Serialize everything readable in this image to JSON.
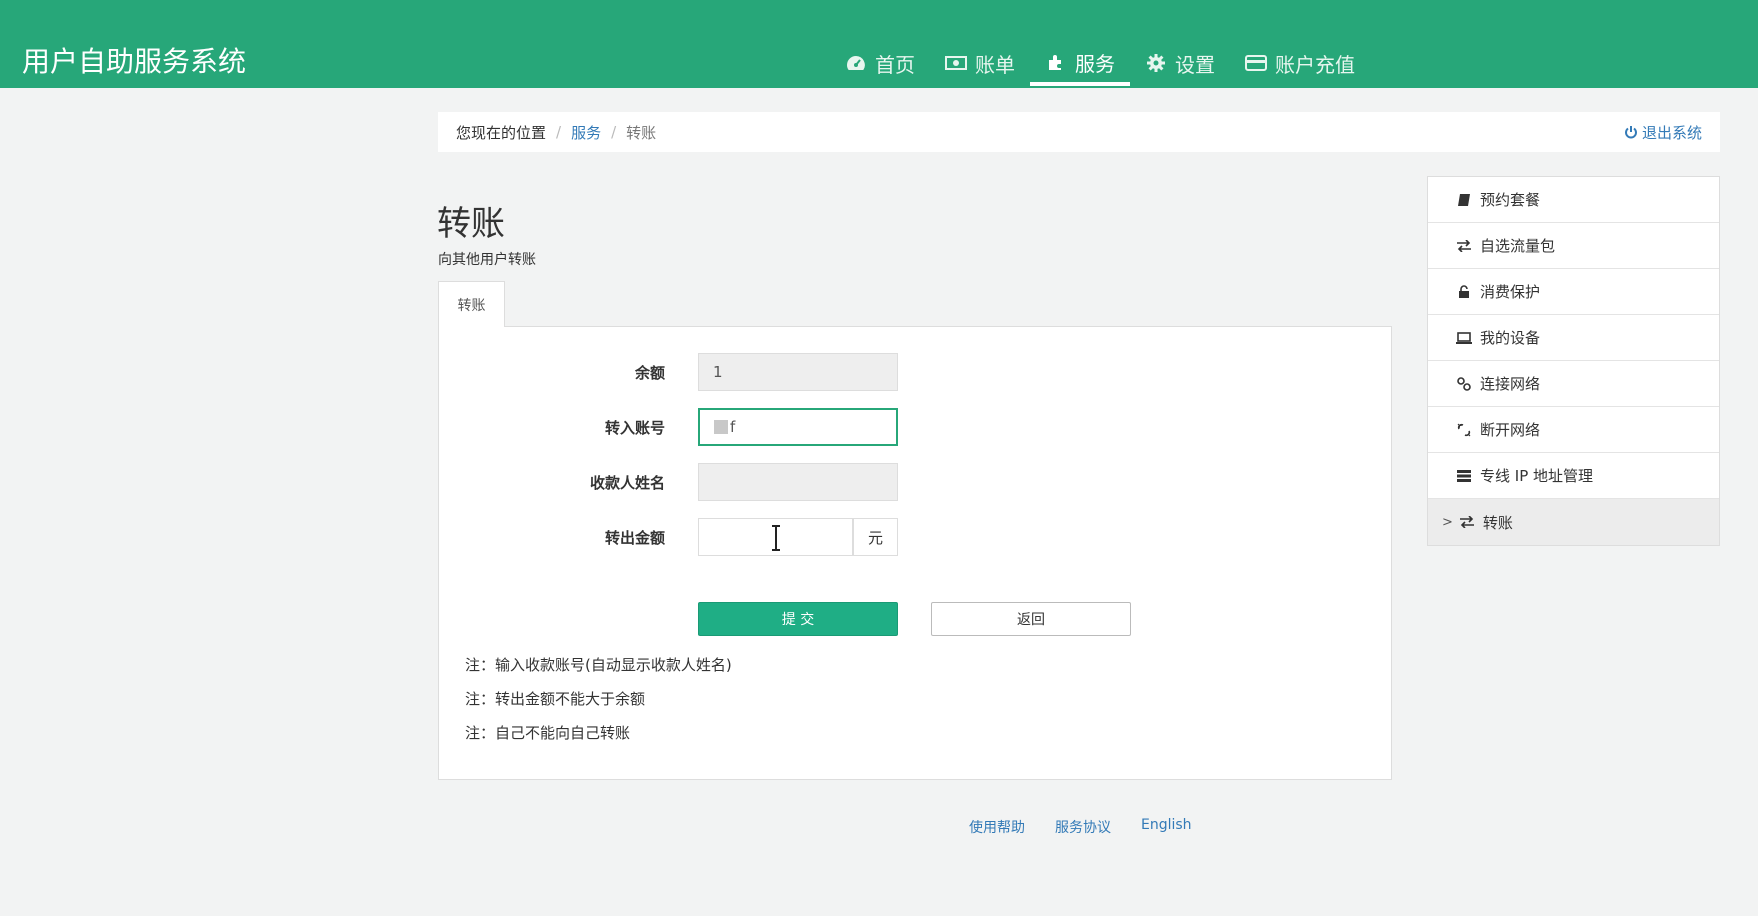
{
  "header": {
    "title": "用户自助服务系统",
    "nav": [
      {
        "label": "首页",
        "icon": "dashboard-icon"
      },
      {
        "label": "账单",
        "icon": "money-icon"
      },
      {
        "label": "服务",
        "icon": "puzzle-icon",
        "active": true
      },
      {
        "label": "设置",
        "icon": "gear-icon"
      },
      {
        "label": "账户充值",
        "icon": "credit-card-icon"
      }
    ]
  },
  "breadcrumb": {
    "prefix": "您现在的位置",
    "items": [
      "服务",
      "转账"
    ],
    "sep": "/",
    "logout": "退出系统"
  },
  "page": {
    "title": "转账",
    "subtitle": "向其他用户转账",
    "tab": "转账"
  },
  "form": {
    "balance_label": "余额",
    "balance_value": "1",
    "account_label": "转入账号",
    "account_value": "f",
    "name_label": "收款人姓名",
    "name_value": "",
    "amount_label": "转出金额",
    "amount_value": "",
    "amount_unit": "元",
    "submit": "提 交",
    "back": "返回"
  },
  "notes": [
    "注：输入收款账号(自动显示收款人姓名)",
    "注：转出金额不能大于余额",
    "注：自己不能向自己转账"
  ],
  "sidebar": {
    "items": [
      {
        "label": "预约套餐",
        "icon": "book-icon"
      },
      {
        "label": "自选流量包",
        "icon": "exchange-icon"
      },
      {
        "label": "消费保护",
        "icon": "unlock-icon"
      },
      {
        "label": "我的设备",
        "icon": "laptop-icon"
      },
      {
        "label": "连接网络",
        "icon": "link-icon"
      },
      {
        "label": "断开网络",
        "icon": "unlink-icon"
      },
      {
        "label": "专线 IP 地址管理",
        "icon": "server-icon"
      },
      {
        "label": "转账",
        "icon": "exchange-icon",
        "active": true,
        "caret": ">"
      }
    ]
  },
  "footer": {
    "links": [
      "使用帮助",
      "服务协议",
      "English"
    ]
  },
  "colors": {
    "brand": "#27a779",
    "button": "#1fae85",
    "link": "#337ab7"
  }
}
